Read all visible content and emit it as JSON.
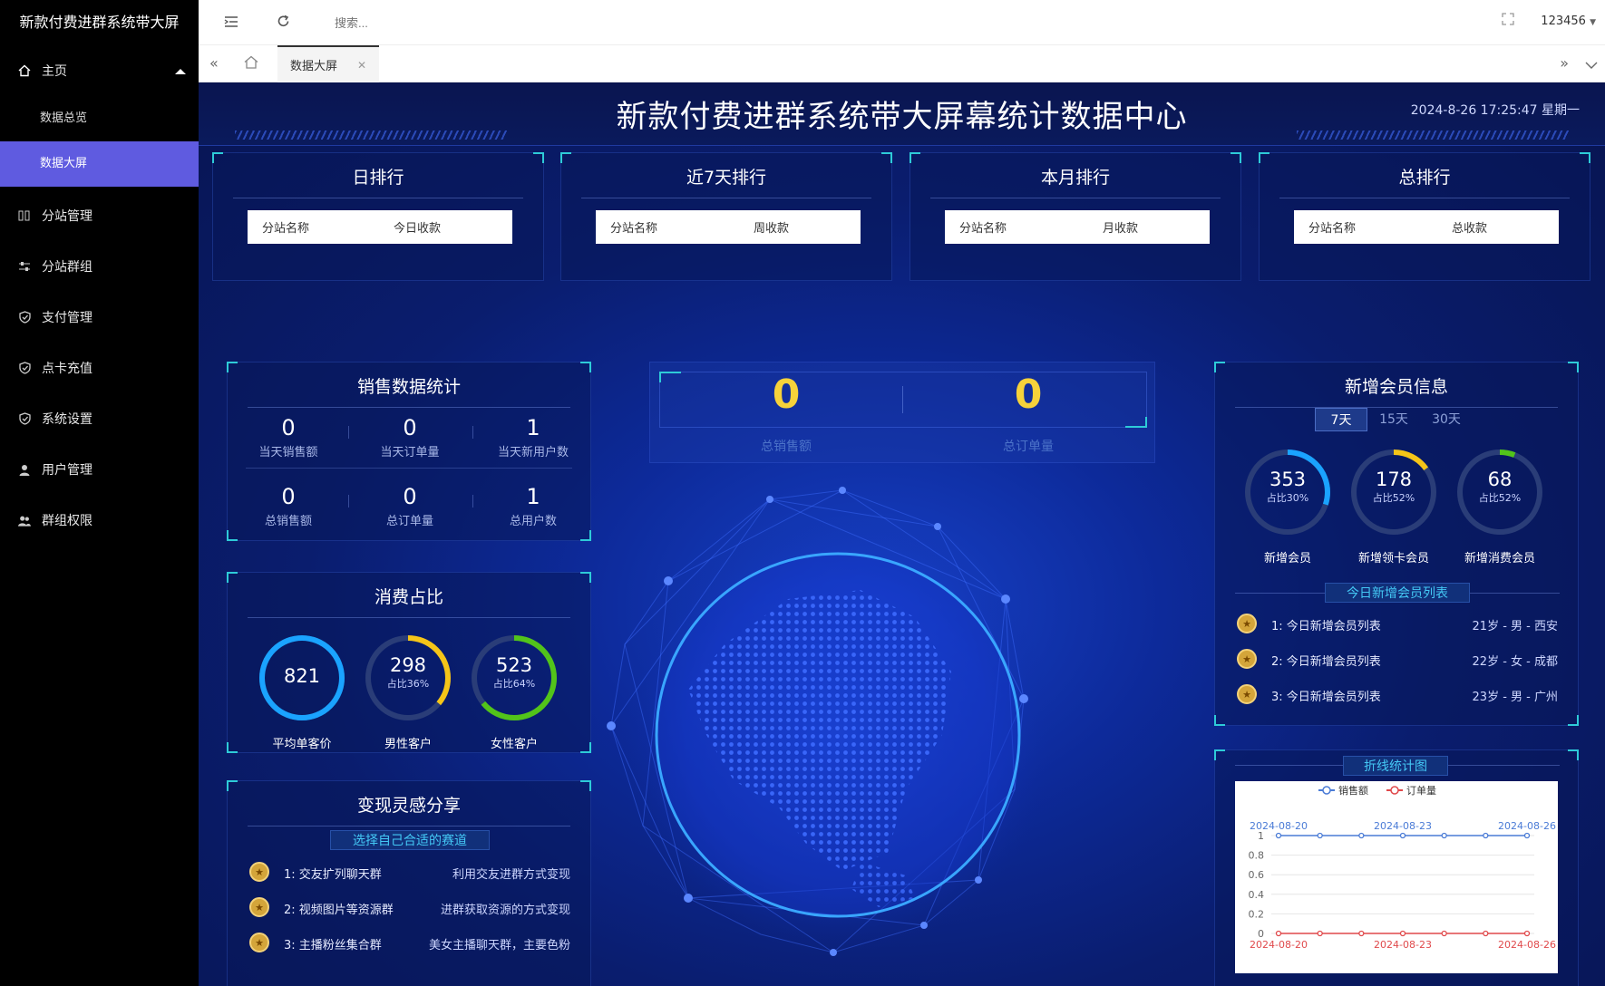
{
  "app": {
    "title": "新款付费进群系统带大屏"
  },
  "sidebar": {
    "home_label": "主页",
    "sub_items": [
      {
        "label": "数据总览"
      },
      {
        "label": "数据大屏"
      }
    ],
    "items": [
      {
        "label": "分站管理",
        "icon": "columns-icon"
      },
      {
        "label": "分站群组",
        "icon": "sliders-icon"
      },
      {
        "label": "支付管理",
        "icon": "shield-icon"
      },
      {
        "label": "点卡充值",
        "icon": "shield-icon"
      },
      {
        "label": "系统设置",
        "icon": "shield-icon"
      },
      {
        "label": "用户管理",
        "icon": "user-icon"
      },
      {
        "label": "群组权限",
        "icon": "users-icon"
      }
    ]
  },
  "topbar": {
    "search_placeholder": "搜索...",
    "user": "123456"
  },
  "tabs": {
    "active": "数据大屏"
  },
  "dashboard": {
    "title": "新款付费进群系统带大屏幕统计数据中心",
    "datetime": "2024-8-26 17:25:47 星期一",
    "rankings": [
      {
        "title": "日排行",
        "col1": "分站名称",
        "col2": "今日收款"
      },
      {
        "title": "近7天排行",
        "col1": "分站名称",
        "col2": "周收款"
      },
      {
        "title": "本月排行",
        "col1": "分站名称",
        "col2": "月收款"
      },
      {
        "title": "总排行",
        "col1": "分站名称",
        "col2": "总收款"
      }
    ],
    "sales": {
      "title": "销售数据统计",
      "stats": [
        {
          "value": "0",
          "label": "当天销售额"
        },
        {
          "value": "0",
          "label": "当天订单量"
        },
        {
          "value": "1",
          "label": "当天新用户数"
        },
        {
          "value": "0",
          "label": "总销售额"
        },
        {
          "value": "0",
          "label": "总订单量"
        },
        {
          "value": "1",
          "label": "总用户数"
        }
      ]
    },
    "consumption": {
      "title": "消费占比",
      "rings": [
        {
          "value": "821",
          "sub": "",
          "label": "平均单客价",
          "fraction": 1.0,
          "color": "#1aa3ff"
        },
        {
          "value": "298",
          "sub": "占比36%",
          "label": "男性客户",
          "fraction": 0.36,
          "color": "#f5c518"
        },
        {
          "value": "523",
          "sub": "占比64%",
          "label": "女性客户",
          "fraction": 0.64,
          "color": "#52c41a"
        }
      ]
    },
    "share": {
      "title": "变现灵感分享",
      "pill": "选择自己合适的赛道",
      "rows": [
        {
          "left": "1:  交友扩列聊天群",
          "right": "利用交友进群方式变现"
        },
        {
          "left": "2:  视频图片等资源群",
          "right": "进群获取资源的方式变现"
        },
        {
          "left": "3:  主播粉丝集合群",
          "right": "美女主播聊天群，主要色粉"
        }
      ]
    },
    "totals": [
      {
        "value": "0",
        "label": "总销售额"
      },
      {
        "value": "0",
        "label": "总订单量"
      }
    ],
    "members": {
      "title": "新增会员信息",
      "tabs": [
        "7天",
        "15天",
        "30天"
      ],
      "rings": [
        {
          "value": "353",
          "sub": "占比30%",
          "label": "新增会员",
          "fraction": 0.3,
          "color": "#1aa3ff"
        },
        {
          "value": "178",
          "sub": "占比52%",
          "label": "新增领卡会员",
          "fraction": 0.15,
          "color": "#f5c518"
        },
        {
          "value": "68",
          "sub": "占比52%",
          "label": "新增消费会员",
          "fraction": 0.06,
          "color": "#52c41a"
        }
      ],
      "list_title": "今日新增会员列表",
      "list": [
        {
          "left": "1:  今日新增会员列表",
          "right": "21岁 - 男 - 西安"
        },
        {
          "left": "2:  今日新增会员列表",
          "right": "22岁 - 女 - 成都"
        },
        {
          "left": "3:  今日新增会员列表",
          "right": "23岁 - 男 - 广州"
        }
      ]
    },
    "line_chart_title": "折线统计图"
  },
  "chart_data": {
    "type": "line",
    "x": [
      "2024-08-20",
      "2024-08-21",
      "2024-08-22",
      "2024-08-23",
      "2024-08-24",
      "2024-08-25",
      "2024-08-26"
    ],
    "top_ticks": [
      "2024-08-20",
      "2024-08-23",
      "2024-08-26"
    ],
    "bottom_ticks": [
      "2024-08-20",
      "2024-08-23",
      "2024-08-26"
    ],
    "y_ticks": [
      "1",
      "0.8",
      "0.6",
      "0.4",
      "0.2",
      "0"
    ],
    "ylim": [
      0,
      1
    ],
    "series": [
      {
        "name": "销售额",
        "color": "#4a7bd6",
        "values": [
          1,
          1,
          1,
          1,
          1,
          1,
          1
        ]
      },
      {
        "name": "订单量",
        "color": "#e0494b",
        "values": [
          0,
          0,
          0,
          0,
          0,
          0,
          0
        ]
      }
    ],
    "legend": "top"
  }
}
